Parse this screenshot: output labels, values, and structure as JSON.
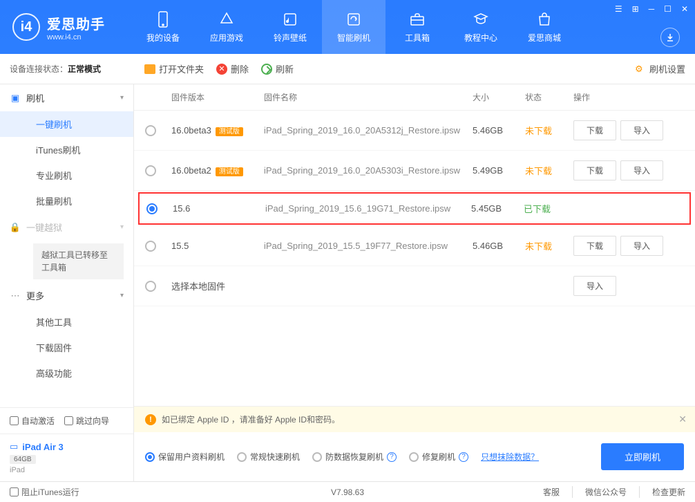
{
  "app": {
    "name": "爱思助手",
    "url": "www.i4.cn"
  },
  "nav": [
    {
      "label": "我的设备"
    },
    {
      "label": "应用游戏"
    },
    {
      "label": "铃声壁纸"
    },
    {
      "label": "智能刷机"
    },
    {
      "label": "工具箱"
    },
    {
      "label": "教程中心"
    },
    {
      "label": "爱思商城"
    }
  ],
  "toolbar": {
    "open_folder": "打开文件夹",
    "delete": "删除",
    "refresh": "刷新",
    "settings": "刷机设置"
  },
  "sidebar": {
    "conn_label": "设备连接状态：",
    "conn_value": "正常模式",
    "flash_group": "刷机",
    "items": [
      "一键刷机",
      "iTunes刷机",
      "专业刷机",
      "批量刷机"
    ],
    "jailbreak_group": "一键越狱",
    "jailbreak_notice": "越狱工具已转移至工具箱",
    "more_group": "更多",
    "more_items": [
      "其他工具",
      "下载固件",
      "高级功能"
    ],
    "auto_activate": "自动激活",
    "skip_wizard": "跳过向导",
    "device_name": "iPad Air 3",
    "device_storage": "64GB",
    "device_type": "iPad"
  },
  "table": {
    "headers": {
      "version": "固件版本",
      "name": "固件名称",
      "size": "大小",
      "status": "状态",
      "ops": "操作"
    },
    "rows": [
      {
        "version": "16.0beta3",
        "beta": "测试版",
        "name": "iPad_Spring_2019_16.0_20A5312j_Restore.ipsw",
        "size": "5.46GB",
        "status": "未下载",
        "status_class": "orange",
        "selected": false,
        "has_ops": true
      },
      {
        "version": "16.0beta2",
        "beta": "测试版",
        "name": "iPad_Spring_2019_16.0_20A5303i_Restore.ipsw",
        "size": "5.49GB",
        "status": "未下载",
        "status_class": "orange",
        "selected": false,
        "has_ops": true
      },
      {
        "version": "15.6",
        "beta": "",
        "name": "iPad_Spring_2019_15.6_19G71_Restore.ipsw",
        "size": "5.45GB",
        "status": "已下载",
        "status_class": "green",
        "selected": true,
        "has_ops": false,
        "highlighted": true
      },
      {
        "version": "15.5",
        "beta": "",
        "name": "iPad_Spring_2019_15.5_19F77_Restore.ipsw",
        "size": "5.46GB",
        "status": "未下载",
        "status_class": "orange",
        "selected": false,
        "has_ops": true
      }
    ],
    "local_row": "选择本地固件",
    "btn_download": "下载",
    "btn_import": "导入"
  },
  "alert": {
    "text": "如已绑定 Apple ID ，请准备好 Apple ID和密码。"
  },
  "flash_opts": {
    "keep_data": "保留用户资料刷机",
    "normal": "常规快速刷机",
    "anti_recovery": "防数据恢复刷机",
    "repair": "修复刷机",
    "erase_link": "只想抹除数据？",
    "flash_btn": "立即刷机"
  },
  "statusbar": {
    "block_itunes": "阻止iTunes运行",
    "version": "V7.98.63",
    "service": "客服",
    "wechat": "微信公众号",
    "check_update": "检查更新"
  }
}
